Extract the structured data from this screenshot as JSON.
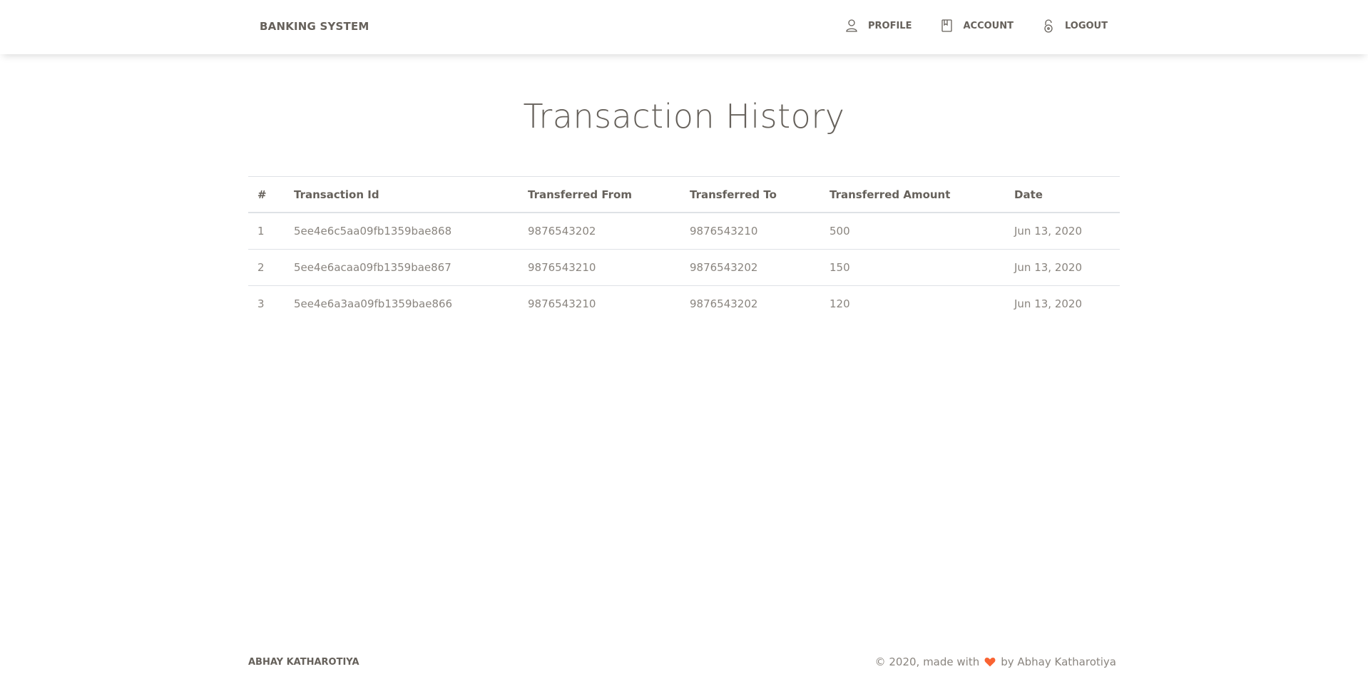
{
  "navbar": {
    "brand": "BANKING SYSTEM",
    "links": [
      {
        "label": "PROFILE",
        "icon": "user-icon"
      },
      {
        "label": "ACCOUNT",
        "icon": "book-icon"
      },
      {
        "label": "LOGOUT",
        "icon": "lock-icon"
      }
    ]
  },
  "page": {
    "title": "Transaction History"
  },
  "table": {
    "headers": [
      "#",
      "Transaction Id",
      "Transferred From",
      "Transferred To",
      "Transferred Amount",
      "Date"
    ],
    "rows": [
      [
        "1",
        "5ee4e6c5aa09fb1359bae868",
        "9876543202",
        "9876543210",
        "500",
        "Jun 13, 2020"
      ],
      [
        "2",
        "5ee4e6acaa09fb1359bae867",
        "9876543210",
        "9876543202",
        "150",
        "Jun 13, 2020"
      ],
      [
        "3",
        "5ee4e6a3aa09fb1359bae866",
        "9876543210",
        "9876543202",
        "120",
        "Jun 13, 2020"
      ]
    ]
  },
  "footer": {
    "left": "ABHAY KATHAROTIYA",
    "right_prefix": "© 2020, made with",
    "right_suffix": "by Abhay Katharotiya",
    "heart_color": "#f96332",
    "heart_icon": "heart-icon"
  },
  "colors": {
    "text": "#66615b",
    "muted": "#8a857f",
    "border": "#dee2e6"
  }
}
